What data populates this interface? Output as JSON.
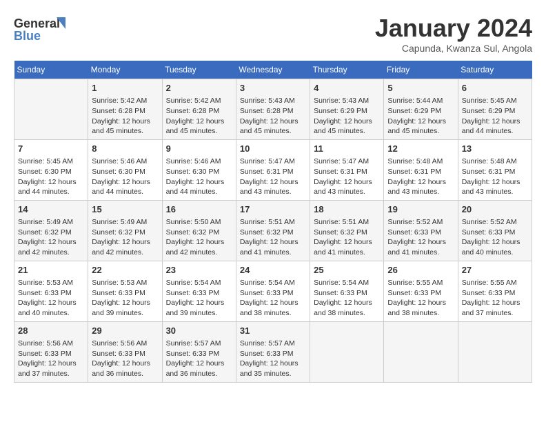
{
  "header": {
    "logo_general": "General",
    "logo_blue": "Blue",
    "month_title": "January 2024",
    "location": "Capunda, Kwanza Sul, Angola"
  },
  "weekdays": [
    "Sunday",
    "Monday",
    "Tuesday",
    "Wednesday",
    "Thursday",
    "Friday",
    "Saturday"
  ],
  "weeks": [
    [
      {
        "day": "",
        "info": ""
      },
      {
        "day": "1",
        "info": "Sunrise: 5:42 AM\nSunset: 6:28 PM\nDaylight: 12 hours\nand 45 minutes."
      },
      {
        "day": "2",
        "info": "Sunrise: 5:42 AM\nSunset: 6:28 PM\nDaylight: 12 hours\nand 45 minutes."
      },
      {
        "day": "3",
        "info": "Sunrise: 5:43 AM\nSunset: 6:28 PM\nDaylight: 12 hours\nand 45 minutes."
      },
      {
        "day": "4",
        "info": "Sunrise: 5:43 AM\nSunset: 6:29 PM\nDaylight: 12 hours\nand 45 minutes."
      },
      {
        "day": "5",
        "info": "Sunrise: 5:44 AM\nSunset: 6:29 PM\nDaylight: 12 hours\nand 45 minutes."
      },
      {
        "day": "6",
        "info": "Sunrise: 5:45 AM\nSunset: 6:29 PM\nDaylight: 12 hours\nand 44 minutes."
      }
    ],
    [
      {
        "day": "7",
        "info": "Sunrise: 5:45 AM\nSunset: 6:30 PM\nDaylight: 12 hours\nand 44 minutes."
      },
      {
        "day": "8",
        "info": "Sunrise: 5:46 AM\nSunset: 6:30 PM\nDaylight: 12 hours\nand 44 minutes."
      },
      {
        "day": "9",
        "info": "Sunrise: 5:46 AM\nSunset: 6:30 PM\nDaylight: 12 hours\nand 44 minutes."
      },
      {
        "day": "10",
        "info": "Sunrise: 5:47 AM\nSunset: 6:31 PM\nDaylight: 12 hours\nand 43 minutes."
      },
      {
        "day": "11",
        "info": "Sunrise: 5:47 AM\nSunset: 6:31 PM\nDaylight: 12 hours\nand 43 minutes."
      },
      {
        "day": "12",
        "info": "Sunrise: 5:48 AM\nSunset: 6:31 PM\nDaylight: 12 hours\nand 43 minutes."
      },
      {
        "day": "13",
        "info": "Sunrise: 5:48 AM\nSunset: 6:31 PM\nDaylight: 12 hours\nand 43 minutes."
      }
    ],
    [
      {
        "day": "14",
        "info": "Sunrise: 5:49 AM\nSunset: 6:32 PM\nDaylight: 12 hours\nand 42 minutes."
      },
      {
        "day": "15",
        "info": "Sunrise: 5:49 AM\nSunset: 6:32 PM\nDaylight: 12 hours\nand 42 minutes."
      },
      {
        "day": "16",
        "info": "Sunrise: 5:50 AM\nSunset: 6:32 PM\nDaylight: 12 hours\nand 42 minutes."
      },
      {
        "day": "17",
        "info": "Sunrise: 5:51 AM\nSunset: 6:32 PM\nDaylight: 12 hours\nand 41 minutes."
      },
      {
        "day": "18",
        "info": "Sunrise: 5:51 AM\nSunset: 6:32 PM\nDaylight: 12 hours\nand 41 minutes."
      },
      {
        "day": "19",
        "info": "Sunrise: 5:52 AM\nSunset: 6:33 PM\nDaylight: 12 hours\nand 41 minutes."
      },
      {
        "day": "20",
        "info": "Sunrise: 5:52 AM\nSunset: 6:33 PM\nDaylight: 12 hours\nand 40 minutes."
      }
    ],
    [
      {
        "day": "21",
        "info": "Sunrise: 5:53 AM\nSunset: 6:33 PM\nDaylight: 12 hours\nand 40 minutes."
      },
      {
        "day": "22",
        "info": "Sunrise: 5:53 AM\nSunset: 6:33 PM\nDaylight: 12 hours\nand 39 minutes."
      },
      {
        "day": "23",
        "info": "Sunrise: 5:54 AM\nSunset: 6:33 PM\nDaylight: 12 hours\nand 39 minutes."
      },
      {
        "day": "24",
        "info": "Sunrise: 5:54 AM\nSunset: 6:33 PM\nDaylight: 12 hours\nand 38 minutes."
      },
      {
        "day": "25",
        "info": "Sunrise: 5:54 AM\nSunset: 6:33 PM\nDaylight: 12 hours\nand 38 minutes."
      },
      {
        "day": "26",
        "info": "Sunrise: 5:55 AM\nSunset: 6:33 PM\nDaylight: 12 hours\nand 38 minutes."
      },
      {
        "day": "27",
        "info": "Sunrise: 5:55 AM\nSunset: 6:33 PM\nDaylight: 12 hours\nand 37 minutes."
      }
    ],
    [
      {
        "day": "28",
        "info": "Sunrise: 5:56 AM\nSunset: 6:33 PM\nDaylight: 12 hours\nand 37 minutes."
      },
      {
        "day": "29",
        "info": "Sunrise: 5:56 AM\nSunset: 6:33 PM\nDaylight: 12 hours\nand 36 minutes."
      },
      {
        "day": "30",
        "info": "Sunrise: 5:57 AM\nSunset: 6:33 PM\nDaylight: 12 hours\nand 36 minutes."
      },
      {
        "day": "31",
        "info": "Sunrise: 5:57 AM\nSunset: 6:33 PM\nDaylight: 12 hours\nand 35 minutes."
      },
      {
        "day": "",
        "info": ""
      },
      {
        "day": "",
        "info": ""
      },
      {
        "day": "",
        "info": ""
      }
    ]
  ]
}
